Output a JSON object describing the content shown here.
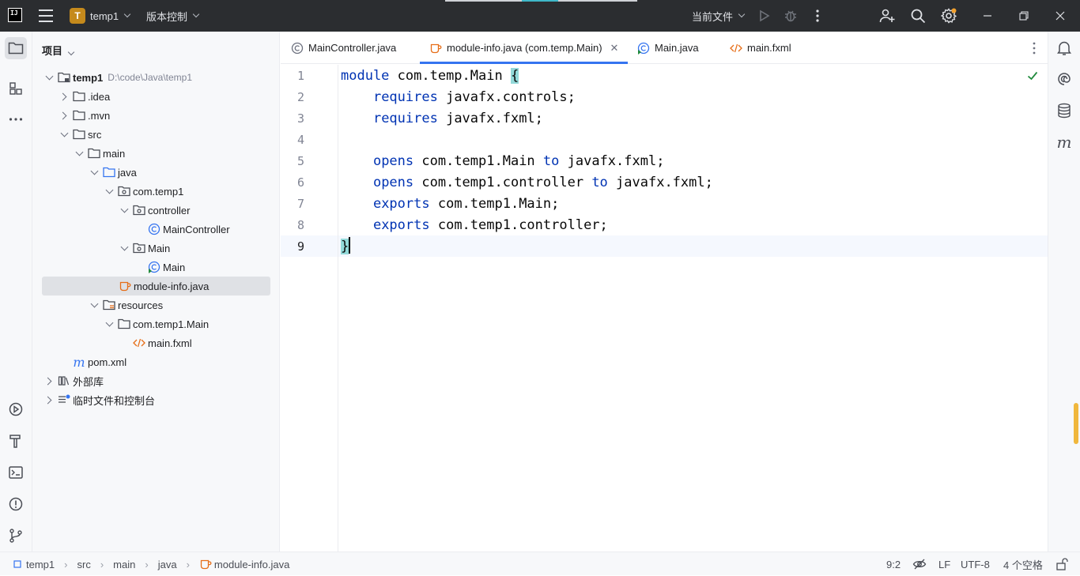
{
  "titlebar": {
    "logo_text": "IJ",
    "project_badge": "T",
    "project_name": "temp1",
    "vcs_label": "版本控制",
    "run_config": "当前文件"
  },
  "project_panel": {
    "title": "项目",
    "root": {
      "name": "temp1",
      "path": "D:\\code\\Java\\temp1"
    },
    "items": [
      {
        "label": ".idea"
      },
      {
        "label": ".mvn"
      },
      {
        "label": "src"
      },
      {
        "label": "main"
      },
      {
        "label": "java"
      },
      {
        "label": "com.temp1"
      },
      {
        "label": "controller"
      },
      {
        "label": "MainController"
      },
      {
        "label": "Main"
      },
      {
        "label": "Main"
      },
      {
        "label": "module-info.java"
      },
      {
        "label": "resources"
      },
      {
        "label": "com.temp1.Main"
      },
      {
        "label": "main.fxml"
      },
      {
        "label": "pom.xml"
      },
      {
        "label": "外部库"
      },
      {
        "label": "临时文件和控制台"
      }
    ]
  },
  "tabs": [
    {
      "label": "MainController.java"
    },
    {
      "label": "module-info.java (com.temp.Main)"
    },
    {
      "label": "Main.java"
    },
    {
      "label": "main.fxml"
    }
  ],
  "editor": {
    "line_numbers": [
      "1",
      "2",
      "3",
      "4",
      "5",
      "6",
      "7",
      "8",
      "9"
    ],
    "lines": [
      {
        "kw": "module",
        "rest": " com.temp.Main ",
        "brace": "{"
      },
      {
        "indent": "    ",
        "kw": "requires",
        "rest": " javafx.controls;"
      },
      {
        "indent": "    ",
        "kw": "requires",
        "rest": " javafx.fxml;"
      },
      {
        "indent": "",
        "kw": "",
        "rest": ""
      },
      {
        "indent": "    ",
        "kw": "opens",
        "rest": " com.temp1.Main ",
        "kw2": "to",
        "rest2": " javafx.fxml;"
      },
      {
        "indent": "    ",
        "kw": "opens",
        "rest": " com.temp1.controller ",
        "kw2": "to",
        "rest2": " javafx.fxml;"
      },
      {
        "indent": "    ",
        "kw": "exports",
        "rest": " com.temp1.Main;"
      },
      {
        "indent": "    ",
        "kw": "exports",
        "rest": " com.temp1.controller;"
      },
      {
        "brace": "}"
      }
    ]
  },
  "statusbar": {
    "breadcrumbs": [
      "temp1",
      "src",
      "main",
      "java",
      "module-info.java"
    ],
    "position": "9:2",
    "line_ending": "LF",
    "encoding": "UTF-8",
    "indent": "4 个空格"
  },
  "colors": {
    "accent": "#3574f0",
    "keyword": "#0033b3",
    "brace_highlight": "#93d9d9",
    "warning_marker": "#f0b73c"
  }
}
